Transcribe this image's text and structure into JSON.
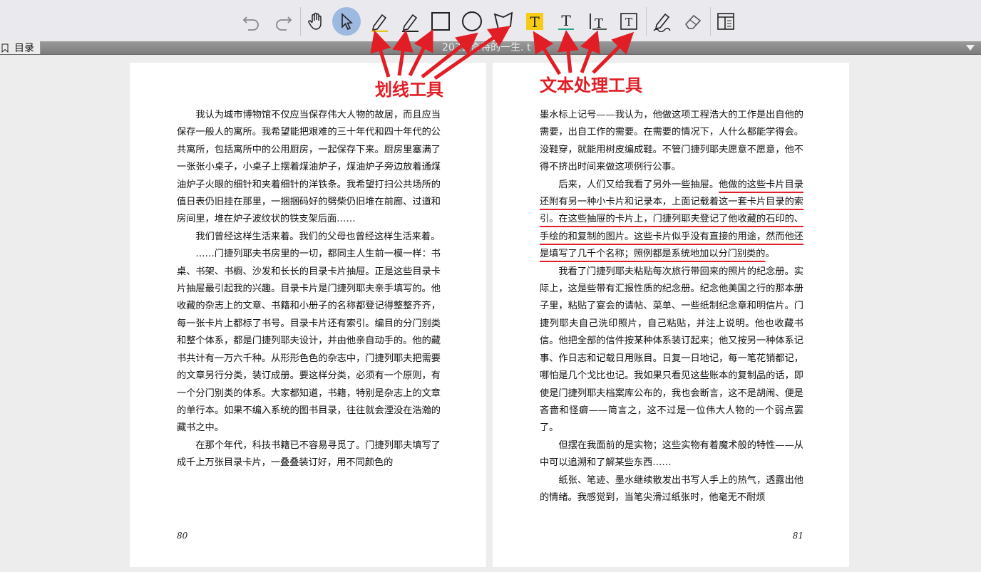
{
  "toolbar": {
    "tools": [
      {
        "name": "undo-icon"
      },
      {
        "name": "redo-icon"
      },
      {
        "name": "hand-icon"
      },
      {
        "name": "select-arrow-icon",
        "active": true
      },
      {
        "name": "highlighter-icon"
      },
      {
        "name": "pencil-icon"
      },
      {
        "name": "rectangle-icon"
      },
      {
        "name": "circle-icon"
      },
      {
        "name": "polygon-icon"
      },
      {
        "name": "text-highlight-icon"
      },
      {
        "name": "text-underline-icon"
      },
      {
        "name": "text-strikeout-icon"
      },
      {
        "name": "text-box-icon"
      },
      {
        "name": "signature-icon"
      },
      {
        "name": "eraser-icon"
      },
      {
        "name": "panel-icon"
      }
    ]
  },
  "titlebar": {
    "toc_label": "目录",
    "doc_title": "2021    奇特的一生.    t"
  },
  "annotations": {
    "drawing_tools": "划线工具",
    "text_tools": "文本处理工具",
    "color": "#e11d25"
  },
  "left_page": {
    "paragraphs": [
      "我认为城市博物馆不仅应当保存伟大人物的故居，而且应当保存一般人的寓所。我希望能把艰难的三十年代和四十年代的公共寓所，包括寓所中的公用厨房，一起保存下来。厨房里塞满了一张张小桌子，小桌子上摆着煤油炉子，煤油炉子旁边放着通煤油炉子火眼的细针和夹着细针的洋铁条。我希望打扫公共场所的值日表仍旧挂在那里，一捆捆码好的劈柴仍旧堆在前廊、过道和房间里，堆在炉子波纹状的铁支架后面……",
      "我们曾经这样生活来着。我们的父母也曾经这样生活来着。",
      "……门捷列耶夫书房里的一切，都同主人生前一模一样：书桌、书架、书橱、沙发和长长的目录卡片抽屉。正是这些目录卡片抽屉最引起我的兴趣。目录卡片是门捷列耶夫亲手填写的。他收藏的杂志上的文章、书籍和小册子的名称都登记得整整齐齐，每一张卡片上都标了书号。目录卡片还有索引。编目的分门别类和整个体系，都是门捷列耶夫设计，并由他亲自动手的。他的藏书共计有一万六千种。从形形色色的杂志中，门捷列耶夫把需要的文章另行分类，装订成册。要这样分类，必须有一个原则，有一个分门别类的体系。大家都知道，书籍，特别是杂志上的文章的单行本。如果不编入系统的图书目录，往往就会湮没在浩瀚的藏书之中。",
      "在那个年代，科技书籍已不容易寻觅了。门捷列耶夫填写了成千上万张目录卡片，一叠叠装订好，用不同颜色的"
    ],
    "page_number": "80"
  },
  "right_page": {
    "p1": "墨水标上记号——我认为，他做这项工程浩大的工作是出自他的需要，出自工作的需要。在需要的情况下，人什么都能学得会。没鞋穿，就能用树皮编成鞋。不管门捷列耶夫愿意不愿意，他不得不挤出时间来做这项例行公事。",
    "p2_pre": "后来，人们又给我看了另外一些抽屉。",
    "p2_underlined": "他做的这些卡片目录还附有另一种小卡片和记录本，上面记载着这一套卡片目录的索引。在这些抽屉的卡片上，门捷列耶夫登记了他收藏的石印的、手绘的和复制的图片。这些卡片似乎没有直接的用途，然而他还是填写了几千个名称；照例都是系统地加以分门别类的",
    "p2_post": "。",
    "p3": "我看了门捷列耶夫粘贴每次旅行带回来的照片的纪念册。实际上，这是些带有汇报性质的纪念册。纪念他美国之行的那本册子里，粘贴了宴会的请帖、菜单、一些纸制纪念章和明信片。门捷列耶夫自己洗印照片，自己粘贴，并注上说明。他也收藏书信。他把全部的信件按某种体系装订起来；他又按另一种体系记事、作日志和记载日用账目。日复一日地记，每一笔花销都记，哪怕是几个戈比也记。我如果只看见这些账本的复制品的话，即使是门捷列耶夫档案库公布的，我也会断言，这不是胡闹、便是吝啬和怪癖——简言之，这不过是一位伟大人物的一个弱点罢了。",
    "p4": "但摆在我面前的是实物；这些实物有着魔术般的特性——从中可以追溯和了解某些东西……",
    "p5": "纸张、笔迹、墨水继续散发出书写人手上的热气，透露出他的情绪。我感觉到，当笔尖滑过纸张时，他毫无不耐烦",
    "page_number": "81"
  }
}
